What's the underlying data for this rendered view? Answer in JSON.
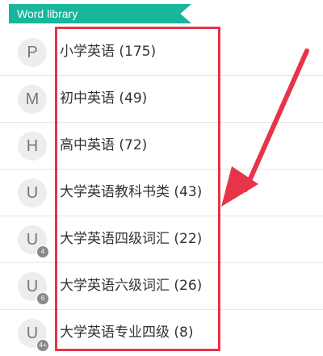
{
  "header": {
    "title": "Word library"
  },
  "items": [
    {
      "letter": "P",
      "label": "小学英语 (175)",
      "badge": ""
    },
    {
      "letter": "M",
      "label": "初中英语 (49)",
      "badge": ""
    },
    {
      "letter": "H",
      "label": "高中英语 (72)",
      "badge": ""
    },
    {
      "letter": "U",
      "label": "大学英语教科书类 (43)",
      "badge": ""
    },
    {
      "letter": "U",
      "label": "大学英语四级词汇 (22)",
      "badge": "4"
    },
    {
      "letter": "U",
      "label": "大学英语六级词汇 (26)",
      "badge": "6"
    },
    {
      "letter": "U",
      "label": "大学英语专业四级 (8)",
      "badge": "4+"
    }
  ],
  "colors": {
    "accent": "#18b69a",
    "annotation": "#e63449"
  },
  "icons": {
    "annotation": "red-arrow-icon"
  }
}
